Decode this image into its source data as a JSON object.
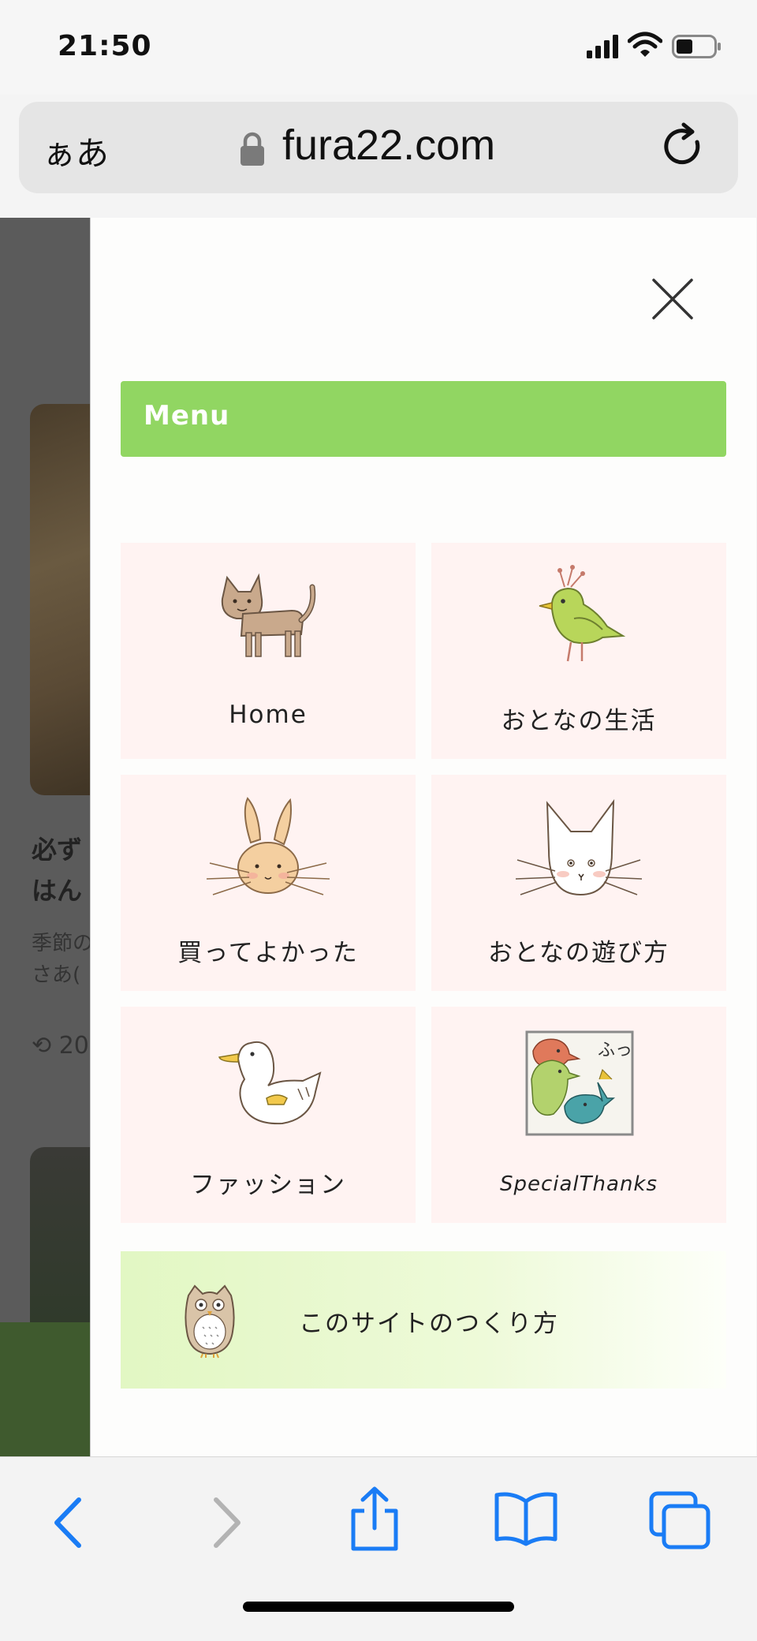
{
  "status": {
    "time": "21:50"
  },
  "browser": {
    "aa_label": "ぁあ",
    "domain": "fura22.com"
  },
  "background": {
    "title_line1": "必ず",
    "title_line2": "はん",
    "desc_line1": "季節の",
    "desc_line2": "さあ(",
    "date": "20"
  },
  "menu": {
    "title": "Menu",
    "tiles": [
      {
        "label": "Home",
        "icon": "cat-icon"
      },
      {
        "label": "おとなの生活",
        "icon": "bird-icon"
      },
      {
        "label": "買ってよかった",
        "icon": "rabbit-icon"
      },
      {
        "label": "おとなの遊び方",
        "icon": "white-cat-icon"
      },
      {
        "label": "ファッション",
        "icon": "duck-icon"
      },
      {
        "label": "SpecialThanks",
        "icon": "birds-picture-icon"
      }
    ],
    "banner_label": "このサイトのつくり方",
    "banner_icon": "owl-icon"
  },
  "colors": {
    "menu_bar": "#91d662",
    "tile_bg": "#fff3f2",
    "toolbar_blue": "#1a7cf5"
  }
}
